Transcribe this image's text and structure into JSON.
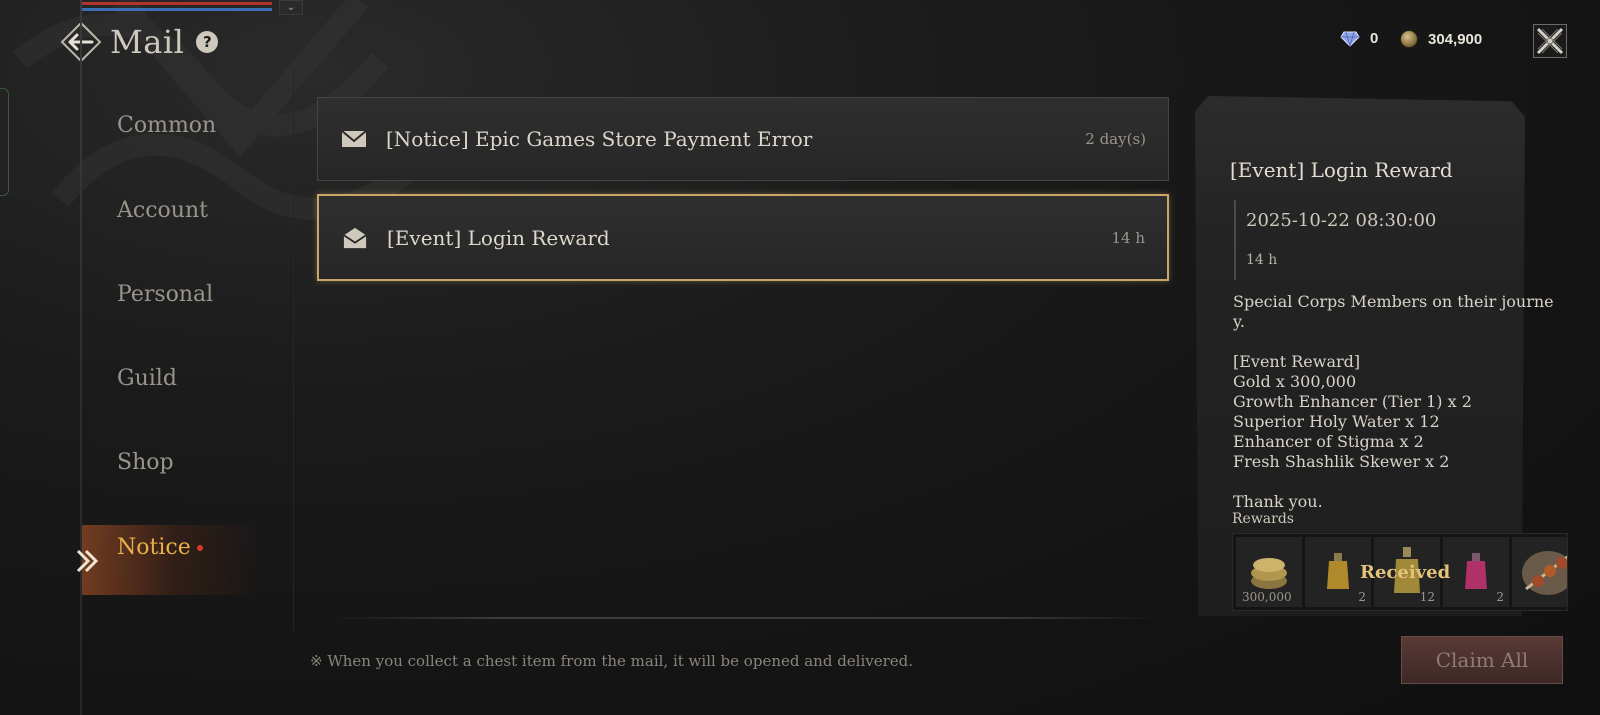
{
  "header": {
    "title": "Mail",
    "back_icon": "back-arrow-icon",
    "help_icon": "help-icon",
    "help_glyph": "?",
    "dropdown_glyph": "⌄"
  },
  "currency": {
    "gem_value": "0",
    "gold_value": "304,900"
  },
  "sidebar": {
    "items": [
      {
        "label": "Common"
      },
      {
        "label": "Account"
      },
      {
        "label": "Personal"
      },
      {
        "label": "Guild"
      },
      {
        "label": "Shop"
      },
      {
        "label": "Notice"
      }
    ],
    "active": "Notice"
  },
  "mail_list": [
    {
      "title": "[Notice] Epic Games Store Payment Error",
      "time": "2 day(s)",
      "icon": "envelope-closed-icon"
    },
    {
      "title": "[Event] Login Reward",
      "time": "14 h",
      "icon": "envelope-open-icon"
    }
  ],
  "detail": {
    "title": "[Event] Login Reward",
    "date": "2025-10-22 08:30:00",
    "expiry": "14 h",
    "body": "Special Corps Members on their journe\ny.\n\n[Event Reward]\nGold x 300,000\nGrowth Enhancer (Tier 1) x 2\nSuperior Holy Water x 12\nEnhancer of Stigma x 2\nFresh Shashlik Skewer x 2\n\nThank you.",
    "rewards_label": "Rewards",
    "received_label": "Received",
    "rewards": [
      {
        "icon": "gold-coins-icon",
        "qty": "300,000"
      },
      {
        "icon": "potion-yellow-icon",
        "qty": "2"
      },
      {
        "icon": "holy-water-icon",
        "qty": "12"
      },
      {
        "icon": "potion-pink-icon",
        "qty": "2"
      },
      {
        "icon": "skewer-icon",
        "qty": ""
      }
    ]
  },
  "footer": {
    "note": "※ When you collect a chest item from the mail, it will be opened and delivered.",
    "claim_all": "Claim All"
  },
  "colors": {
    "accent_gold": "#c9a56a",
    "notice_orange": "#e8b04a",
    "received_gold": "#e4c27a",
    "claim_btn": "#5a3a36"
  }
}
